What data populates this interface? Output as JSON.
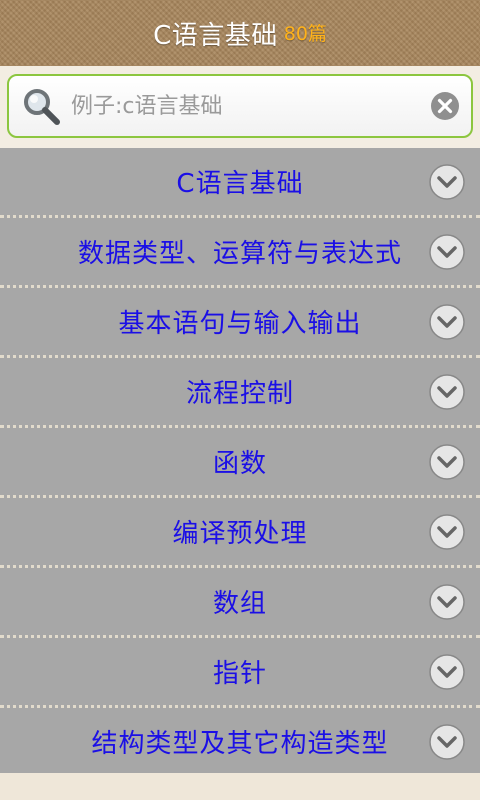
{
  "header": {
    "title": "C语言基础",
    "count": "80篇"
  },
  "search": {
    "placeholder": "例子:c语言基础",
    "icon": "search-icon",
    "clear_icon": "clear-icon"
  },
  "list": {
    "items": [
      {
        "label": "C语言基础"
      },
      {
        "label": "数据类型、运算符与表达式"
      },
      {
        "label": "基本语句与输入输出"
      },
      {
        "label": "流程控制"
      },
      {
        "label": "函数"
      },
      {
        "label": "编译预处理"
      },
      {
        "label": "数组"
      },
      {
        "label": "指针"
      },
      {
        "label": "结构类型及其它构造类型"
      }
    ],
    "chevron_icon": "chevron-down-icon"
  },
  "colors": {
    "header_bg": "#a8865c",
    "title_text": "#ffffff",
    "count_text": "#ffb21a",
    "search_border": "#8cc63f",
    "item_bg": "#a7a7a7",
    "item_text": "#1b0fe6"
  }
}
